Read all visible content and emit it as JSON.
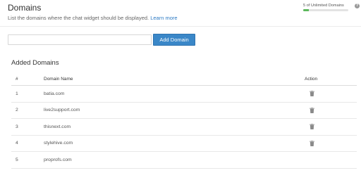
{
  "header": {
    "title": "Domains",
    "subtitle": "List the domains where the chat widget should be displayed.",
    "learn_more": "Learn more"
  },
  "usage": {
    "text": "5 of Unlimited Domains",
    "help_icon": "help-icon",
    "fill_fraction": 0.12,
    "fill_color": "#5cb85c"
  },
  "form": {
    "input_value": "",
    "input_placeholder": "",
    "add_button_label": "Add Domain",
    "button_color": "#3a87c8"
  },
  "section": {
    "title": "Added Domains"
  },
  "table": {
    "columns": [
      "#",
      "Domain Name",
      "Action"
    ],
    "rows": [
      {
        "num": "1",
        "domain": "batia.com",
        "action_icon": "trash-icon"
      },
      {
        "num": "2",
        "domain": "live2support.com",
        "action_icon": "trash-icon"
      },
      {
        "num": "3",
        "domain": "thisnext.com",
        "action_icon": "trash-icon"
      },
      {
        "num": "4",
        "domain": "stylehive.com",
        "action_icon": "trash-icon"
      },
      {
        "num": "5",
        "domain": "proprofs.com",
        "action_icon": ""
      }
    ]
  }
}
